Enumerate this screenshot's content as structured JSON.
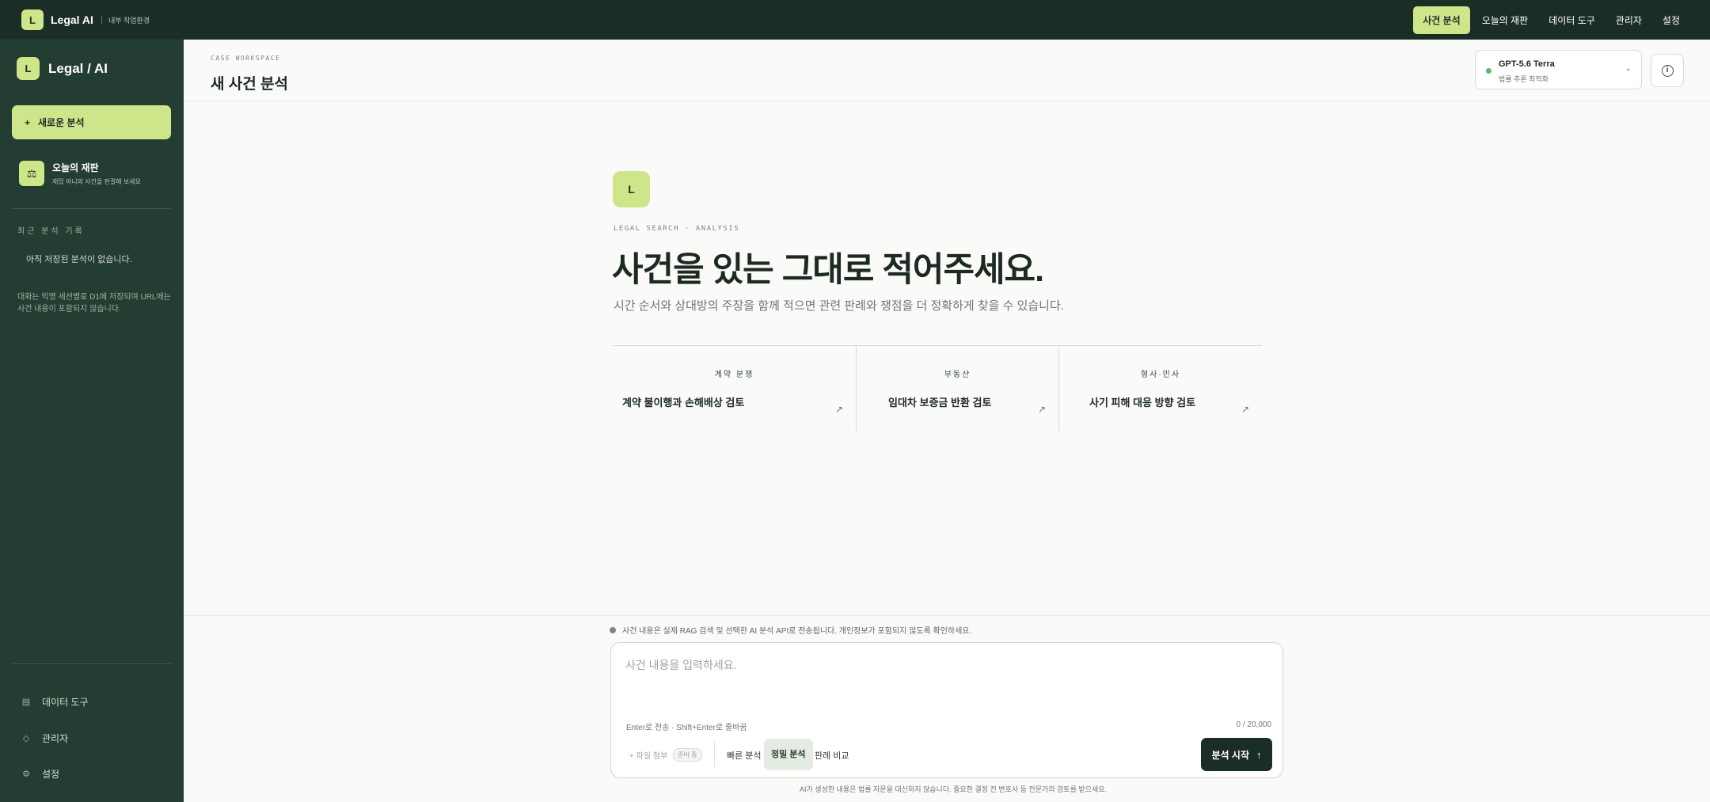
{
  "topbar": {
    "logo_letter": "L",
    "brand": "Legal AI",
    "sub": "내부 작업환경",
    "nav": [
      {
        "label": "사건 분석",
        "active": true
      },
      {
        "label": "오늘의 재판",
        "active": false
      },
      {
        "label": "데이터 도구",
        "active": false
      },
      {
        "label": "관리자",
        "active": false
      },
      {
        "label": "설정",
        "active": false
      }
    ]
  },
  "sidebar": {
    "logo_letter": "L",
    "title": "Legal / AI",
    "new_button": {
      "icon": "+",
      "label": "새로운 분석"
    },
    "trial": {
      "icon": "scale-icon",
      "title": "오늘의 재판",
      "subtitle": "재밌 아니의 사건을 판결해 보세요"
    },
    "recent_label": "최근 분석 기록",
    "empty_text": "아직 저장된 분석이 없습니다.",
    "note": "대화는 익명 세션별로 D1에 저장되며 URL에는 사건 내용이 포함되지 않습니다.",
    "bottom_items": [
      {
        "icon": "grid-icon",
        "glyph": "▤",
        "label": "데이터 도구"
      },
      {
        "icon": "diamond-icon",
        "glyph": "◇",
        "label": "관리자"
      },
      {
        "icon": "gear-icon",
        "glyph": "⚙",
        "label": "설정"
      }
    ]
  },
  "header": {
    "eyebrow": "CASE WORKSPACE",
    "title": "새 사건 분석",
    "model": {
      "name": "GPT-5.6 Terra",
      "sub": "법률 추론 최적화",
      "status_color": "#4fbf6e"
    },
    "info_glyph": "i"
  },
  "hero": {
    "badge": "L",
    "eyebrow": "LEGAL SEARCH · ANALYSIS",
    "title": "사건을 있는 그대로 적어주세요.",
    "description": "시간 순서와 상대방의 주장을 함께 적으면 관련 판례와 쟁점을 더 정확하게 찾을 수 있습니다."
  },
  "cards": [
    {
      "category": "계약 분쟁",
      "title": "계약 불이행과 손해배상 검토",
      "arrow": "↗"
    },
    {
      "category": "부동산",
      "title": "임대차 보증금 반환 검토",
      "arrow": "↗"
    },
    {
      "category": "형사·민사",
      "title": "사기 피해 대응 방향 검토",
      "arrow": "↗"
    }
  ],
  "composer": {
    "notice": "사건 내용은 실제 RAG 검색 및 선택한 AI 분석 API로 전송됩니다. 개인정보가 포함되지 않도록 확인하세요.",
    "placeholder": "사건 내용을 입력하세요.",
    "hint": "Enter로 전송 · Shift+Enter로 줄바꿈",
    "counter": "0 / 20,000",
    "attach_label": "+ 파일 첨부",
    "attach_badge": "준비 중",
    "modes": [
      {
        "label": "빠른 분석",
        "active": false
      },
      {
        "label": "정밀 분석",
        "active": true
      },
      {
        "label": "판례 비교",
        "active": false
      }
    ],
    "submit_label": "분석 시작",
    "submit_icon": "↑"
  },
  "disclaimer": "AI가 생성한 내용은 법률 자문을 대신하지 않습니다. 중요한 결정 전 변호사 등 전문가의 검토를 받으세요."
}
